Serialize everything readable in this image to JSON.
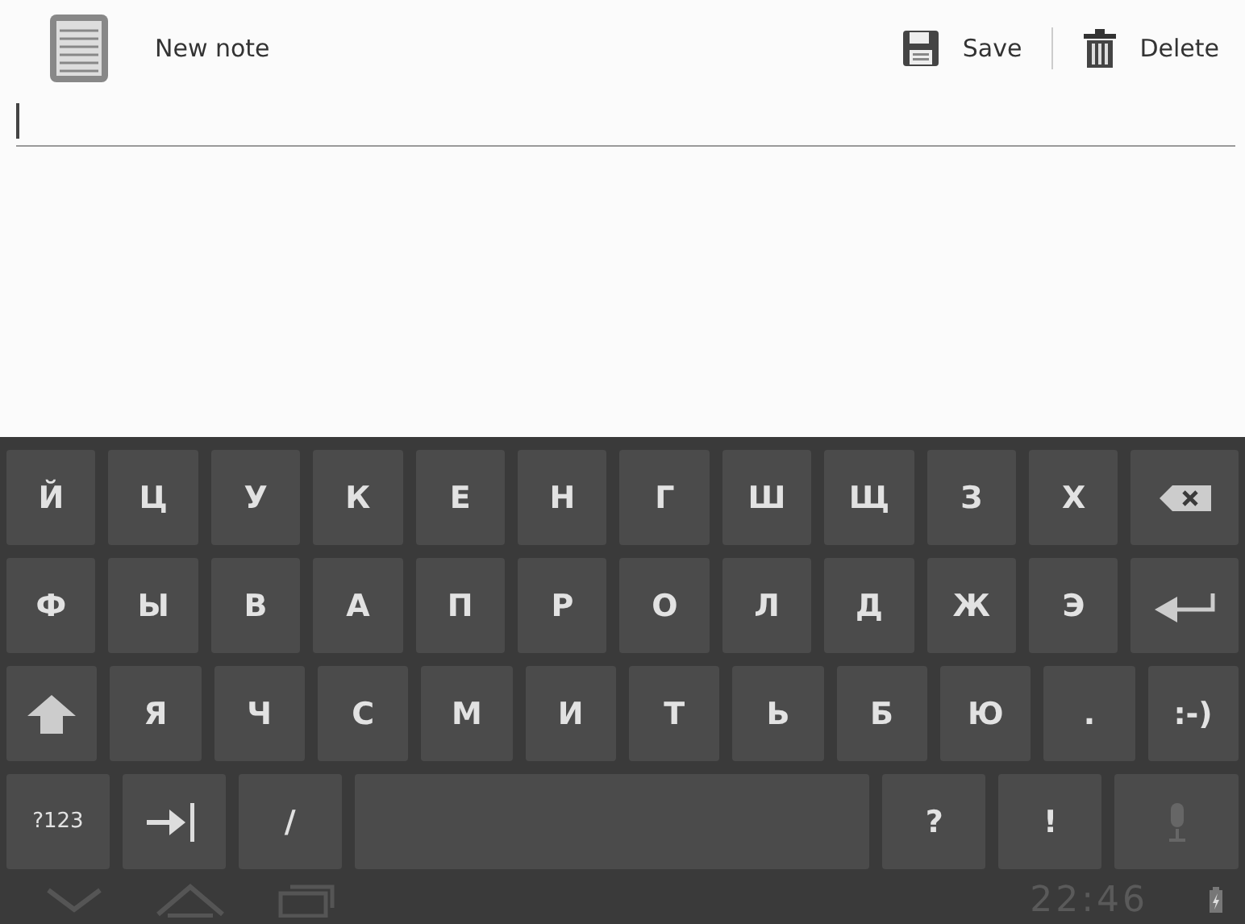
{
  "action_bar": {
    "title": "New note",
    "actions": [
      {
        "kind": "save",
        "label": "Save"
      },
      {
        "kind": "delete",
        "label": "Delete"
      }
    ]
  },
  "note_field": {
    "focused": true
  },
  "keyboard": {
    "rows": [
      [
        {
          "kind": "char",
          "label": "Й"
        },
        {
          "kind": "char",
          "label": "Ц"
        },
        {
          "kind": "char",
          "label": "У"
        },
        {
          "kind": "char",
          "label": "К"
        },
        {
          "kind": "char",
          "label": "Е"
        },
        {
          "kind": "char",
          "label": "Н"
        },
        {
          "kind": "char",
          "label": "Г"
        },
        {
          "kind": "char",
          "label": "Ш"
        },
        {
          "kind": "char",
          "label": "Щ"
        },
        {
          "kind": "char",
          "label": "З"
        },
        {
          "kind": "char",
          "label": "Х"
        },
        {
          "kind": "backspace"
        }
      ],
      [
        {
          "kind": "char",
          "label": "Ф"
        },
        {
          "kind": "char",
          "label": "Ы"
        },
        {
          "kind": "char",
          "label": "В"
        },
        {
          "kind": "char",
          "label": "А"
        },
        {
          "kind": "char",
          "label": "П"
        },
        {
          "kind": "char",
          "label": "Р"
        },
        {
          "kind": "char",
          "label": "О"
        },
        {
          "kind": "char",
          "label": "Л"
        },
        {
          "kind": "char",
          "label": "Д"
        },
        {
          "kind": "char",
          "label": "Ж"
        },
        {
          "kind": "char",
          "label": "Э"
        },
        {
          "kind": "enter"
        }
      ],
      [
        {
          "kind": "shift"
        },
        {
          "kind": "char",
          "label": "Я"
        },
        {
          "kind": "char",
          "label": "Ч"
        },
        {
          "kind": "char",
          "label": "С"
        },
        {
          "kind": "char",
          "label": "М"
        },
        {
          "kind": "char",
          "label": "И"
        },
        {
          "kind": "char",
          "label": "Т"
        },
        {
          "kind": "char",
          "label": "Ь"
        },
        {
          "kind": "char",
          "label": "Б"
        },
        {
          "kind": "char",
          "label": "Ю"
        },
        {
          "kind": "char",
          "label": "."
        },
        {
          "kind": "char",
          "label": ":-)"
        }
      ],
      [
        {
          "kind": "mode",
          "label": "?123"
        },
        {
          "kind": "tab"
        },
        {
          "kind": "char",
          "label": "/"
        },
        {
          "kind": "space"
        },
        {
          "kind": "char",
          "label": "?"
        },
        {
          "kind": "char",
          "label": "!"
        },
        {
          "kind": "mic"
        }
      ]
    ]
  },
  "nav_bar": {
    "buttons": [
      {
        "kind": "back"
      },
      {
        "kind": "home"
      },
      {
        "kind": "recent"
      }
    ],
    "clock": "22:46",
    "charging": true
  }
}
